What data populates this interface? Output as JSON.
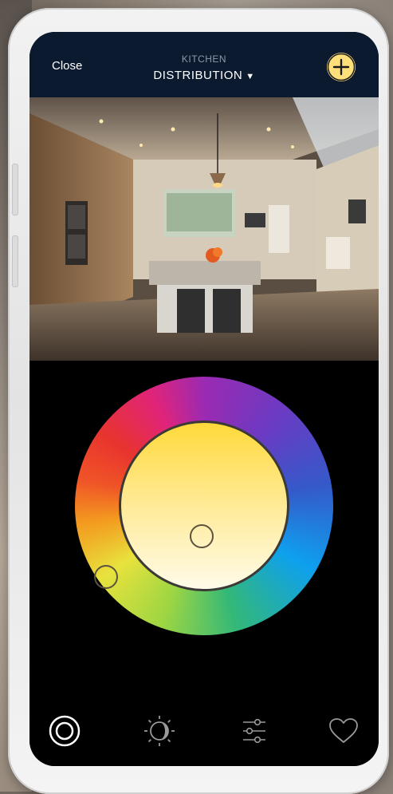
{
  "header": {
    "close_label": "Close",
    "room_name": "KITCHEN",
    "scene_name": "DISTRIBUTION",
    "dropdown_caret": "▼",
    "add_icon": "plus-icon"
  },
  "photo": {
    "subject": "kitchen-room-photo"
  },
  "brightness": {
    "level": 0.8
  },
  "color_wheel": {
    "selected_hue_color": "#e8e23d",
    "selected_white_color": "#ffe98f"
  },
  "tabbar": {
    "items": [
      {
        "icon": "color-wheel-icon",
        "active": true
      },
      {
        "icon": "day-night-icon",
        "active": false
      },
      {
        "icon": "sliders-icon",
        "active": false
      },
      {
        "icon": "heart-icon",
        "active": false
      }
    ]
  },
  "colors": {
    "header_bg": "#0b1a2e",
    "accent_yellow": "#fde07a",
    "screen_bg": "#000000"
  }
}
